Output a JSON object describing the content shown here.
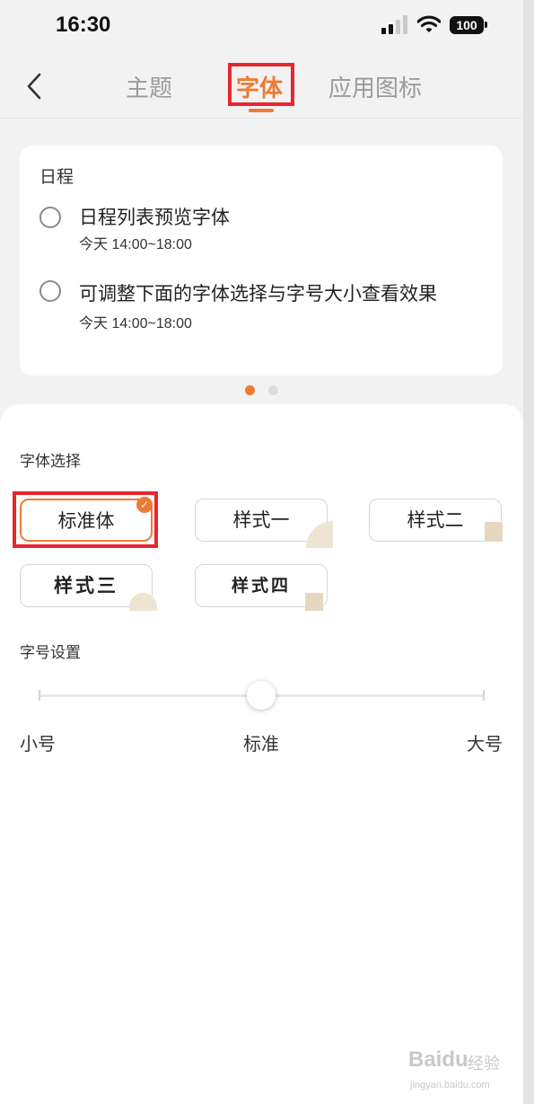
{
  "status_bar": {
    "time": "16:30",
    "battery": "100"
  },
  "nav": {
    "tabs": [
      {
        "label": "主题",
        "active": false
      },
      {
        "label": "字体",
        "active": true
      },
      {
        "label": "应用图标",
        "active": false
      }
    ]
  },
  "preview": {
    "title": "日程",
    "items": [
      {
        "title": "日程列表预览字体",
        "time": "今天 14:00~18:00"
      },
      {
        "title": "可调整下面的字体选择与字号大小查看效果",
        "time": "今天 14:00~18:00"
      }
    ],
    "pager": {
      "total": 2,
      "current": 1
    }
  },
  "font_selection": {
    "label": "字体选择",
    "options": [
      {
        "label": "标准体",
        "selected": true
      },
      {
        "label": "样式一",
        "selected": false
      },
      {
        "label": "样式二",
        "selected": false
      },
      {
        "label": "样式三",
        "selected": false
      },
      {
        "label": "样式四",
        "selected": false
      }
    ]
  },
  "font_size": {
    "label": "字号设置",
    "min_label": "小号",
    "mid_label": "标准",
    "max_label": "大号",
    "value": "标准"
  },
  "watermark": {
    "brand": "Baidu",
    "cn": "经验",
    "url": "jingyan.baidu.com"
  },
  "colors": {
    "accent": "#ef7a32",
    "annotation": "#e8262d"
  }
}
